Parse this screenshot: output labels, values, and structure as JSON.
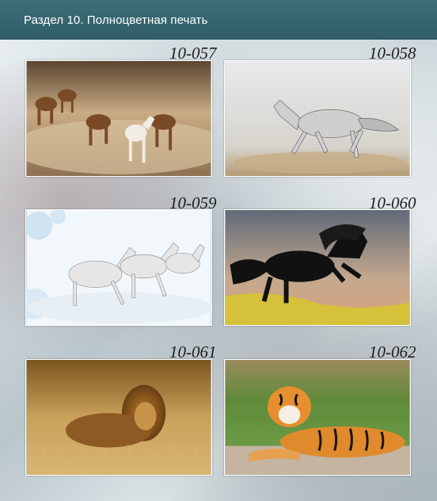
{
  "header": {
    "title": "Раздел 10. Полноцветная печать"
  },
  "items": [
    {
      "code": "10-057",
      "icon": "running-horses-herd"
    },
    {
      "code": "10-058",
      "icon": "white-horse-galloping"
    },
    {
      "code": "10-059",
      "icon": "white-horses-snow"
    },
    {
      "code": "10-060",
      "icon": "black-horse-rearing"
    },
    {
      "code": "10-061",
      "icon": "lion-in-grass"
    },
    {
      "code": "10-062",
      "icon": "tiger-lying"
    }
  ]
}
